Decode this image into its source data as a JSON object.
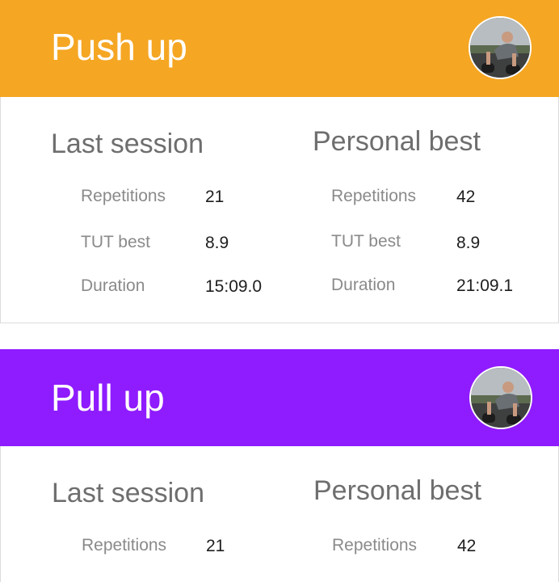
{
  "colors": {
    "pushup_header": "#f5a623",
    "pullup_header": "#8f1bff"
  },
  "cards": [
    {
      "title": "Push up",
      "avatar_icon": "athlete-photo-icon",
      "last_session": {
        "heading": "Last session",
        "stats": [
          {
            "label": "Repetitions",
            "value": "21"
          },
          {
            "label": "TUT best",
            "value": "8.9"
          },
          {
            "label": "Duration",
            "value": "15:09.0"
          }
        ]
      },
      "personal_best": {
        "heading": "Personal best",
        "stats": [
          {
            "label": "Repetitions",
            "value": "42"
          },
          {
            "label": "TUT best",
            "value": "8.9"
          },
          {
            "label": "Duration",
            "value": "21:09.1"
          }
        ]
      }
    },
    {
      "title": "Pull up",
      "avatar_icon": "athlete-photo-icon",
      "last_session": {
        "heading": "Last session",
        "stats": [
          {
            "label": "Repetitions",
            "value": "21"
          }
        ]
      },
      "personal_best": {
        "heading": "Personal best",
        "stats": [
          {
            "label": "Repetitions",
            "value": "42"
          }
        ]
      }
    }
  ]
}
